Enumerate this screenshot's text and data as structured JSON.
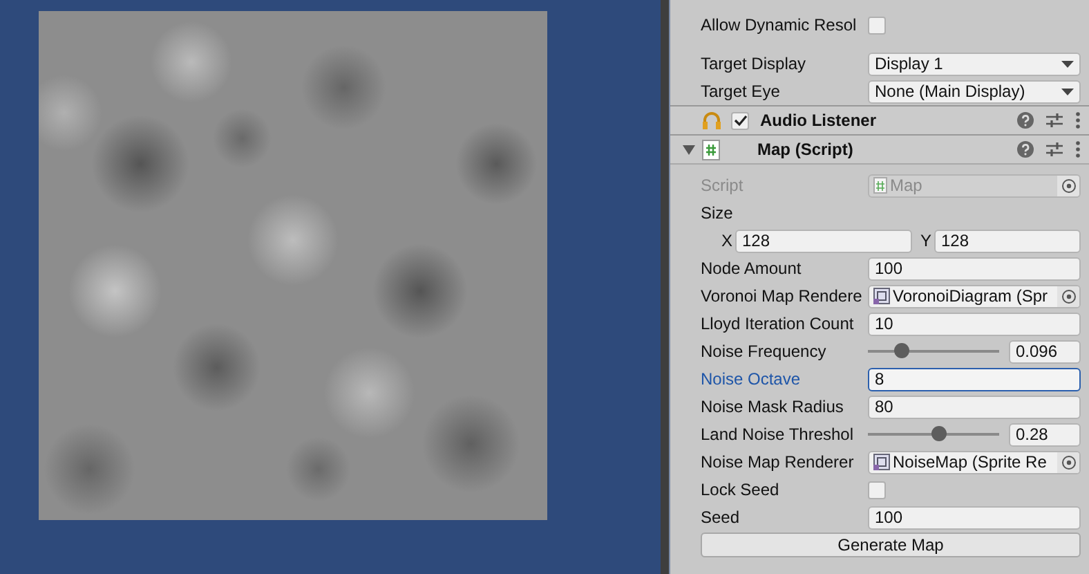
{
  "inspector": {
    "sections": [
      {
        "rows": [
          {
            "kind": "checkbox",
            "label": "Allow Dynamic Resol",
            "checked": false
          }
        ]
      },
      {
        "rows": [
          {
            "kind": "dropdown",
            "label": "Target Display",
            "value": "Display 1"
          },
          {
            "kind": "dropdown",
            "label": "Target Eye",
            "value": "None (Main Display)"
          }
        ]
      }
    ],
    "components": [
      {
        "kind": "audio",
        "title": "Audio Listener",
        "checked": true
      },
      {
        "kind": "script",
        "title": "Map (Script)",
        "expanded": true,
        "rows": [
          {
            "kind": "object",
            "label": "Script",
            "value": "Map",
            "disabled": true
          },
          {
            "kind": "heading",
            "label": "Size"
          },
          {
            "kind": "vector2",
            "fields": [
              {
                "axis": "X",
                "value": "128"
              },
              {
                "axis": "Y",
                "value": "128"
              }
            ]
          },
          {
            "kind": "text",
            "label": "Node Amount",
            "value": "100",
            "focused": false
          },
          {
            "kind": "object",
            "label": "Voronoi Map Rendere",
            "value": "VoronoiDiagram (Spr",
            "disabled": false
          },
          {
            "kind": "text",
            "label": "Lloyd Iteration Count",
            "value": "10",
            "focused": false
          },
          {
            "kind": "slider",
            "label": "Noise Frequency",
            "level": 0.25,
            "value": "0.096"
          },
          {
            "kind": "text",
            "label": "Noise Octave",
            "value": "8",
            "focused": true
          },
          {
            "kind": "text",
            "label": "Noise Mask Radius",
            "value": "80",
            "focused": false
          },
          {
            "kind": "slider",
            "label": "Land Noise Threshol",
            "level": 0.54,
            "value": "0.28"
          },
          {
            "kind": "object",
            "label": "Noise Map Renderer",
            "value": "NoiseMap (Sprite Re",
            "disabled": false
          },
          {
            "kind": "checkbox",
            "label": "Lock Seed",
            "checked": false
          },
          {
            "kind": "text",
            "label": "Seed",
            "value": "100",
            "focused": false
          },
          {
            "kind": "button",
            "label": "Generate Map"
          }
        ]
      }
    ]
  }
}
